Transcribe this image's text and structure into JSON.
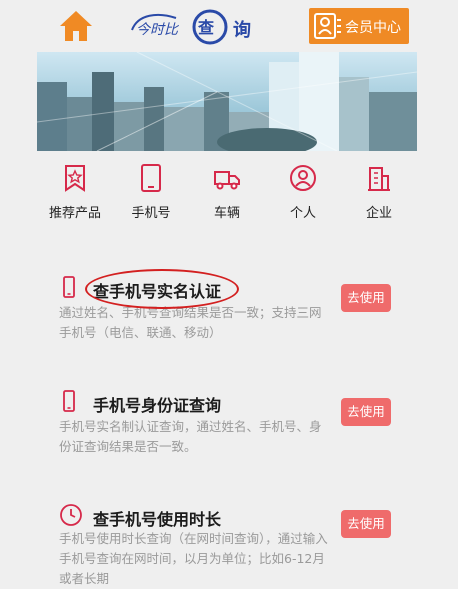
{
  "header": {
    "logo_text": "询",
    "member_label": "会员中心"
  },
  "nav": {
    "items": [
      {
        "label": "推荐产品",
        "icon": "star-bookmark-icon"
      },
      {
        "label": "手机号",
        "icon": "phone-icon"
      },
      {
        "label": "车辆",
        "icon": "truck-icon"
      },
      {
        "label": "个人",
        "icon": "person-icon"
      },
      {
        "label": "企业",
        "icon": "building-icon"
      }
    ]
  },
  "cards": [
    {
      "title": "查手机号实名认证",
      "desc": "通过姓名、手机号查询结果是否一致；支持三网手机号（电信、联通、移动）",
      "button": "去使用",
      "icon": "phone-icon"
    },
    {
      "title": "手机号身份证查询",
      "desc": "手机号实名制认证查询，通过姓名、手机号、身份证查询结果是否一致。",
      "button": "去使用",
      "icon": "phone-icon"
    },
    {
      "title": "查手机号使用时长",
      "desc": "手机号使用时长查询（在网时间查询），通过输入手机号查询在网时间，以月为单位；比如6-12月或者长期",
      "button": "去使用",
      "icon": "clock-icon"
    }
  ],
  "colors": {
    "accent_red": "#d6294a",
    "button_red": "#ef6b6b",
    "member_orange": "#ef8a25",
    "home_orange": "#f08a24"
  }
}
